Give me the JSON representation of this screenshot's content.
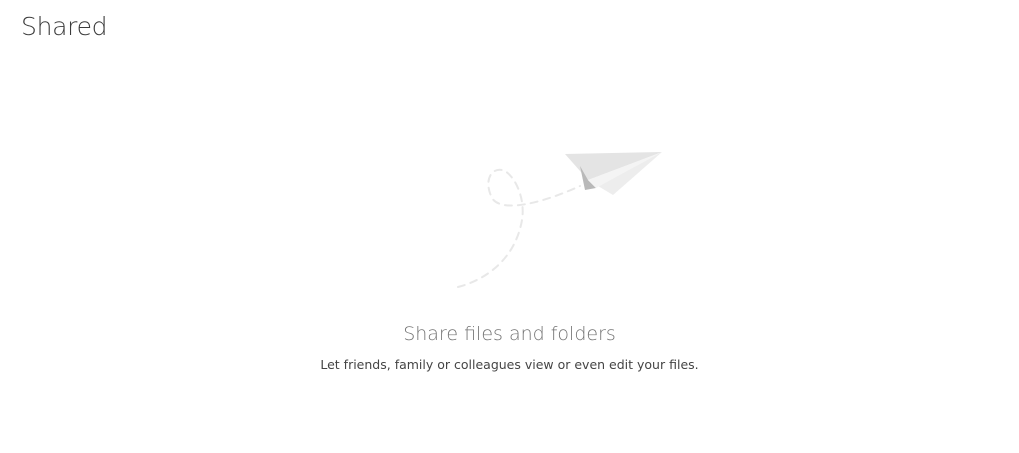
{
  "page": {
    "title": "Shared"
  },
  "empty_state": {
    "illustration_icon": "paper-plane-icon",
    "heading": "Share files and folders",
    "message": "Let friends, family or colleagues view or even edit your files."
  },
  "colors": {
    "title": "#3b3b3b",
    "heading": "#737373",
    "message": "#444444",
    "plane_light": "#ececec",
    "plane_shadow": "#b8b8b8",
    "trail": "#e6e6e6"
  }
}
